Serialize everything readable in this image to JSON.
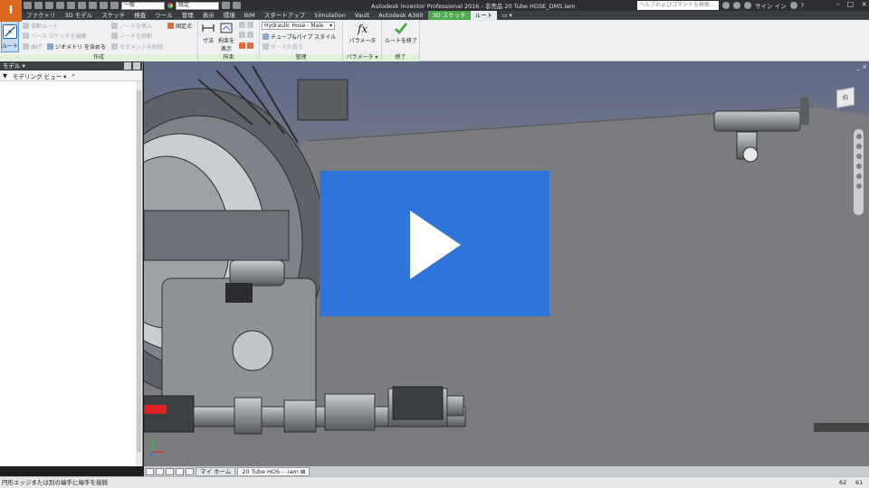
{
  "app": {
    "logo_letter": "I",
    "window_title": "Autodesk Inventor Professional 2016 - 非売品    20 Tube HOSE_DMS.iam",
    "help_search_placeholder": "ヘルプおよびコマンドを検索...",
    "signin_label": "サイン イン",
    "help_label": "?"
  },
  "quick_access": {
    "style_value": "一般",
    "color_value": "既定"
  },
  "menu_tabs": [
    {
      "label": "ファクトリ"
    },
    {
      "label": "3D モデル"
    },
    {
      "label": "スケッチ"
    },
    {
      "label": "検査"
    },
    {
      "label": "ツール"
    },
    {
      "label": "管理"
    },
    {
      "label": "表示"
    },
    {
      "label": "環境"
    },
    {
      "label": "BIM"
    },
    {
      "label": "スタートアップ"
    },
    {
      "label": "Simulation"
    },
    {
      "label": "Vault"
    },
    {
      "label": "Autodesk A360"
    },
    {
      "label": "3D スケッチ",
      "context": true
    },
    {
      "label": "ルート",
      "active": true
    }
  ],
  "ribbon": {
    "create": {
      "title": "作成",
      "route_label": "ルート",
      "auto_route": "自動ルート",
      "base_sketch": "ベース スケッチを編集",
      "bend": "曲げ",
      "include_geometry": "ジオメトリ を含める",
      "insert_node": "ノードを挿入",
      "move_node": "ノードを移動",
      "delete_segment": "セグメントを削除",
      "fixed_point": "固定点"
    },
    "constrain": {
      "title": "拘束",
      "dimension": "寸法",
      "show_constraints": "拘束を表示"
    },
    "manage": {
      "title": "管理",
      "hose_style": "Hydraulic Hose - Male",
      "tube_pipe_style": "チューブ&パイプ スタイル",
      "hose_length": "ホースの長さ"
    },
    "parameters": {
      "title": "パラメータ ▾",
      "label": "パラメータ"
    },
    "exit": {
      "title": "終了",
      "label": "ルートを終了"
    }
  },
  "browser": {
    "title": "モデル ▾",
    "view_label": "モデリング ビュー"
  },
  "viewport": {
    "viewcube_label": "右"
  },
  "doc_tabs": {
    "home": "マイ ホーム",
    "doc": "20 Tube HOS - .iam"
  },
  "status": {
    "message": "円形エッジまたは別の端手に端手を接続",
    "count1": "62",
    "count2": "61"
  },
  "colors": {
    "overlay_blue": "#2f74d8",
    "context_tab_green": "#4fa84f",
    "logo_orange": "#d96a1e"
  }
}
